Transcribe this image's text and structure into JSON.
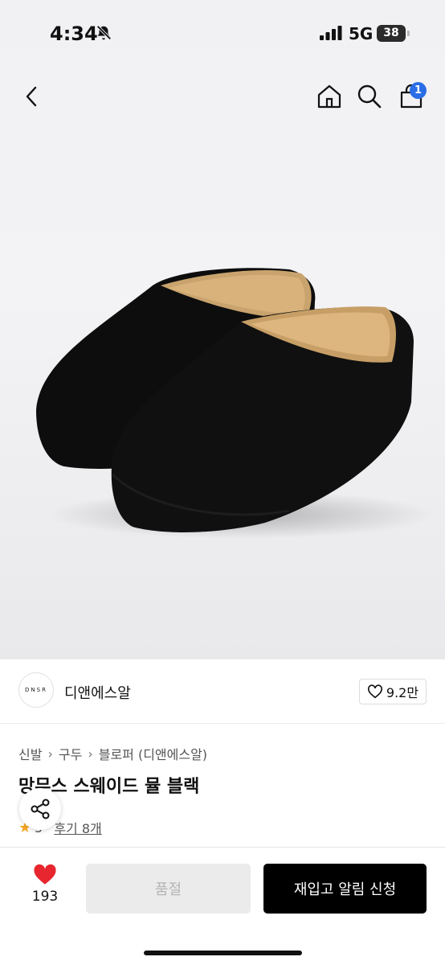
{
  "status_bar": {
    "time": "4:34",
    "network": "5G",
    "battery": "38"
  },
  "nav": {
    "cart_count": "1"
  },
  "brand": {
    "logo_text": "DNSR",
    "name": "디앤에스알",
    "like_count": "9.2만"
  },
  "breadcrumb": [
    "신발",
    "구두",
    "블로퍼 (디앤에스알)"
  ],
  "product": {
    "title": "망무스 스웨이드 뮬 블랙",
    "rating": "5",
    "review_label": "후기 8개"
  },
  "bottom_bar": {
    "like_count": "193",
    "soldout_label": "품절",
    "restock_label": "재입고 알림 신청"
  },
  "colors": {
    "accent_badge": "#2a6de6",
    "heart": "#e8262f",
    "star": "#f5a623",
    "primary_button": "#000000"
  },
  "icons": [
    "bell-off-icon",
    "signal-icon",
    "back-icon",
    "home-icon",
    "search-icon",
    "cart-icon",
    "heart-outline-icon",
    "share-icon",
    "star-icon",
    "heart-filled-icon"
  ]
}
